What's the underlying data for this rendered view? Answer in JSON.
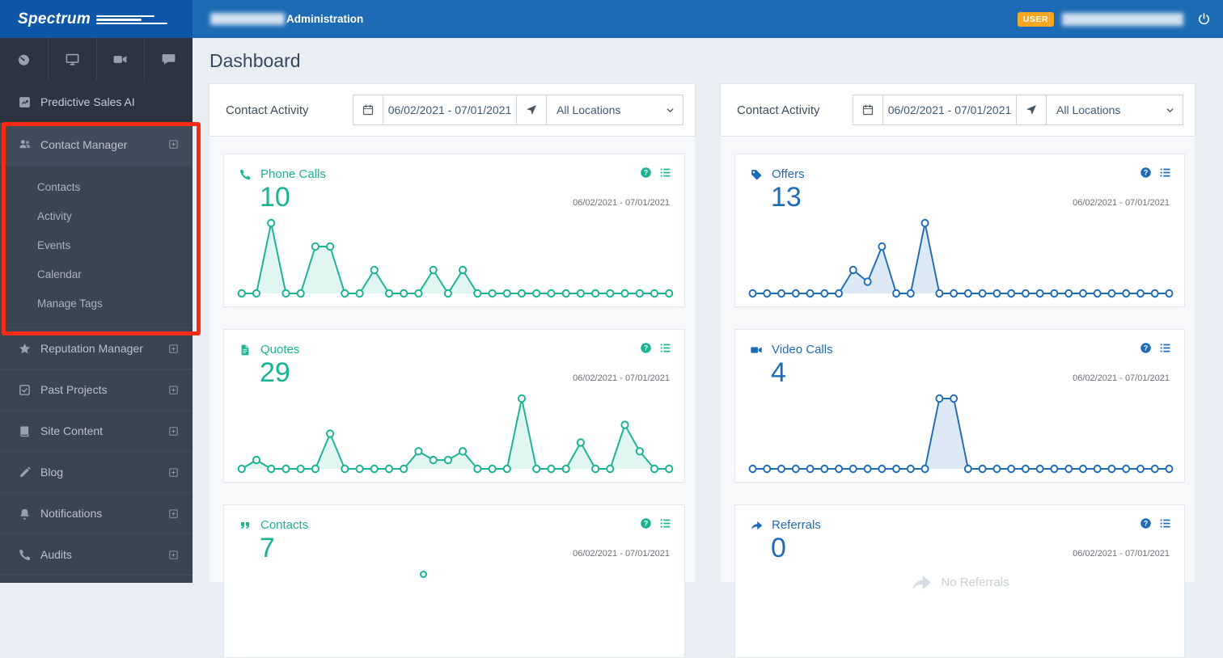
{
  "brand": {
    "name": "Spectrum"
  },
  "topbar": {
    "app_title": "Administration",
    "user_badge": "USER",
    "account_name_redacted": true,
    "username_redacted": true
  },
  "page_title": "Dashboard",
  "sidebar": {
    "top_tabs": [
      {
        "name": "dashboard",
        "icon": "gauge"
      },
      {
        "name": "website",
        "icon": "monitor"
      },
      {
        "name": "video",
        "icon": "video"
      },
      {
        "name": "messages",
        "icon": "chat"
      }
    ],
    "predictive_item": {
      "label": "Predictive Sales AI",
      "icon": "trending"
    },
    "contact_manager": {
      "label": "Contact Manager",
      "icon": "users",
      "expand_icon": "plus-square",
      "submenu": [
        "Contacts",
        "Activity",
        "Events",
        "Calendar",
        "Manage Tags"
      ]
    },
    "items": [
      {
        "label": "Reputation Manager",
        "icon": "star"
      },
      {
        "label": "Past Projects",
        "icon": "check-square"
      },
      {
        "label": "Site Content",
        "icon": "book"
      },
      {
        "label": "Blog",
        "icon": "pencil"
      },
      {
        "label": "Notifications",
        "icon": "bell"
      },
      {
        "label": "Audits",
        "icon": "phone"
      }
    ],
    "annotation": {
      "highlights": "Contact Manager section",
      "color": "#f92b15"
    }
  },
  "filters": {
    "label": "Contact Activity",
    "date_range": "06/02/2021 - 07/01/2021",
    "location": "All Locations"
  },
  "colors": {
    "teal": "#1ab394",
    "teal_fill": "rgba(26,179,148,0.13)",
    "blue": "#1e6cb5",
    "blue_fill": "rgba(30,108,181,0.15)",
    "topbar_blue": "#1d6bb4",
    "logo_blue": "#0e57a8",
    "sidebar_dark": "#3a4552",
    "user_badge_orange": "#f5a623",
    "annotation_red": "#f92b15"
  },
  "columns": [
    {
      "cards": [
        {
          "title": "Phone Calls",
          "value": "10",
          "icon": "phone",
          "accent": "teal",
          "date_range": "06/02/2021 - 07/01/2021",
          "chart_index": 0
        },
        {
          "title": "Quotes",
          "value": "29",
          "icon": "file",
          "accent": "teal",
          "date_range": "06/02/2021 - 07/01/2021",
          "chart_index": 1
        },
        {
          "title": "Contacts",
          "value": "7",
          "icon": "quote",
          "accent": "teal",
          "date_range": "06/02/2021 - 07/01/2021",
          "partial": true,
          "visible_point": true
        }
      ]
    },
    {
      "cards": [
        {
          "title": "Offers",
          "value": "13",
          "icon": "tag",
          "accent": "blue",
          "date_range": "06/02/2021 - 07/01/2021",
          "chart_index": 2
        },
        {
          "title": "Video Calls",
          "value": "4",
          "icon": "video",
          "accent": "blue",
          "date_range": "06/02/2021 - 07/01/2021",
          "chart_index": 3
        },
        {
          "title": "Referrals",
          "value": "0",
          "icon": "share",
          "accent": "blue",
          "date_range": "06/02/2021 - 07/01/2021",
          "partial": true,
          "empty_label": "No Referrals"
        }
      ]
    }
  ],
  "chart_data": [
    {
      "type": "line",
      "title": "Phone Calls",
      "total": 10,
      "date_range": "06/02/2021 - 07/01/2021",
      "x": "daily values for 30 days",
      "values": [
        0,
        0,
        3,
        0,
        0,
        2,
        2,
        0,
        0,
        1,
        0,
        0,
        0,
        1,
        0,
        1,
        0,
        0,
        0,
        0,
        0,
        0,
        0,
        0,
        0,
        0,
        0,
        0,
        0,
        0
      ]
    },
    {
      "type": "line",
      "title": "Quotes",
      "total": 29,
      "date_range": "06/02/2021 - 07/01/2021",
      "x": "daily values for 30 days",
      "values": [
        0,
        1,
        0,
        0,
        0,
        0,
        4,
        0,
        0,
        0,
        0,
        0,
        2,
        1,
        1,
        2,
        0,
        0,
        0,
        8,
        0,
        0,
        0,
        3,
        0,
        0,
        5,
        2,
        0,
        0
      ]
    },
    {
      "type": "line",
      "title": "Offers",
      "total": 13,
      "date_range": "06/02/2021 - 07/01/2021",
      "x": "daily values for 30 days",
      "values": [
        0,
        0,
        0,
        0,
        0,
        0,
        0,
        2,
        1,
        4,
        0,
        0,
        6,
        0,
        0,
        0,
        0,
        0,
        0,
        0,
        0,
        0,
        0,
        0,
        0,
        0,
        0,
        0,
        0,
        0
      ]
    },
    {
      "type": "line",
      "title": "Video Calls",
      "total": 4,
      "date_range": "06/02/2021 - 07/01/2021",
      "x": "daily values for 30 days",
      "values": [
        0,
        0,
        0,
        0,
        0,
        0,
        0,
        0,
        0,
        0,
        0,
        0,
        0,
        2,
        2,
        0,
        0,
        0,
        0,
        0,
        0,
        0,
        0,
        0,
        0,
        0,
        0,
        0,
        0,
        0
      ]
    }
  ]
}
